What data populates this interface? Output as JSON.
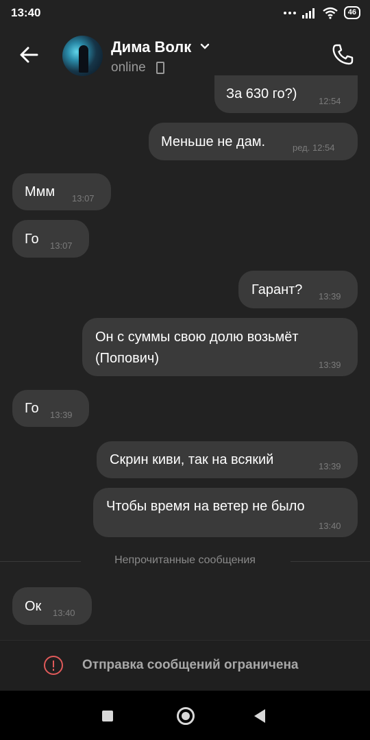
{
  "status_bar": {
    "time": "13:40",
    "battery": "46"
  },
  "header": {
    "contact_name": "Дима Волк",
    "contact_status": "online"
  },
  "messages": [
    {
      "side": "out",
      "text": "За 630 го?)",
      "time": "12:54"
    },
    {
      "side": "out",
      "text": "Меньше не дам.",
      "time": "ред. 12:54"
    },
    {
      "side": "in",
      "text": "Ммм",
      "time": "13:07"
    },
    {
      "side": "in",
      "text": "Го",
      "time": "13:07"
    },
    {
      "side": "out",
      "text": "Гарант?",
      "time": "13:39"
    },
    {
      "side": "out",
      "text_line1": "Он с суммы свою долю возьмёт",
      "text_line2": "(Попович)",
      "time": "13:39"
    },
    {
      "side": "in",
      "text": "Го",
      "time": "13:39"
    },
    {
      "side": "out",
      "text": "Скрин киви, так на всякий",
      "time": "13:39"
    },
    {
      "side": "out",
      "text": "Чтобы время на ветер не было",
      "time": "13:40"
    },
    {
      "side": "in",
      "text": "Ок",
      "time": "13:40"
    }
  ],
  "unread_divider": "Непрочитанные сообщения",
  "restricted_notice": "Отправка сообщений ограничена",
  "icons": {
    "back": "arrow-left-icon",
    "call": "phone-icon",
    "chevron": "chevron-down-icon",
    "warning": "warning-icon",
    "device": "phone-device-icon"
  },
  "colors": {
    "background": "#222222",
    "bubble": "#3a3a3a",
    "warning": "#e05a5a"
  }
}
